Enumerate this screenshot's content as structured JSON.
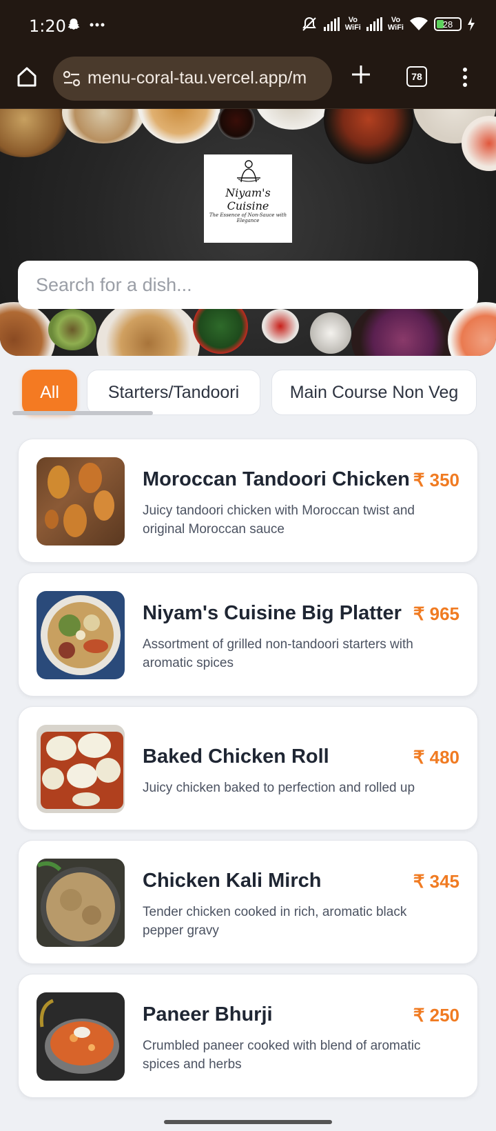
{
  "status_bar": {
    "time": "1:20",
    "battery": "28",
    "icons": [
      "snapchat-icon",
      "more-dots-icon",
      "mute-icon",
      "signal-icon",
      "vowifi-icon",
      "signal-icon",
      "vowifi-icon",
      "wifi-icon",
      "battery-icon",
      "charging-icon"
    ],
    "vowifi_label": "Vo\nWiFi"
  },
  "browser": {
    "url": "menu-coral-tau.vercel.app/m",
    "tab_count": "78",
    "icons": [
      "home-icon",
      "tune-icon",
      "plus-icon",
      "tabs-icon",
      "more-vert-icon"
    ]
  },
  "hero": {
    "brand_name": "Niyam's Cuisine",
    "brand_tagline": "The Essence of Non-Sauce with Elegance",
    "search_placeholder": "Search for a dish..."
  },
  "categories": {
    "items": [
      {
        "label": "All",
        "active": true
      },
      {
        "label": "Starters/Tandoori",
        "active": false
      },
      {
        "label": "Main Course Non Veg",
        "active": false
      }
    ]
  },
  "menu": {
    "items": [
      {
        "name": "Moroccan Tandoori Chicken",
        "price": "₹ 350",
        "description": "Juicy tandoori chicken with Moroccan twist and original Moroccan sauce"
      },
      {
        "name": "Niyam's Cuisine Big Platter",
        "price": "₹ 965",
        "description": "Assortment of grilled non-tandoori starters with aromatic spices"
      },
      {
        "name": "Baked Chicken Roll",
        "price": "₹ 480",
        "description": "Juicy chicken baked to perfection and rolled up"
      },
      {
        "name": "Chicken Kali Mirch",
        "price": "₹ 345",
        "description": "Tender chicken cooked in rich, aromatic black pepper gravy"
      },
      {
        "name": "Paneer Bhurji",
        "price": "₹ 250",
        "description": "Crumbled paneer cooked with blend of aromatic spices and herbs"
      }
    ]
  },
  "colors": {
    "accent": "#f47a22",
    "price": "#f07b22",
    "browser_bg": "#221812"
  }
}
